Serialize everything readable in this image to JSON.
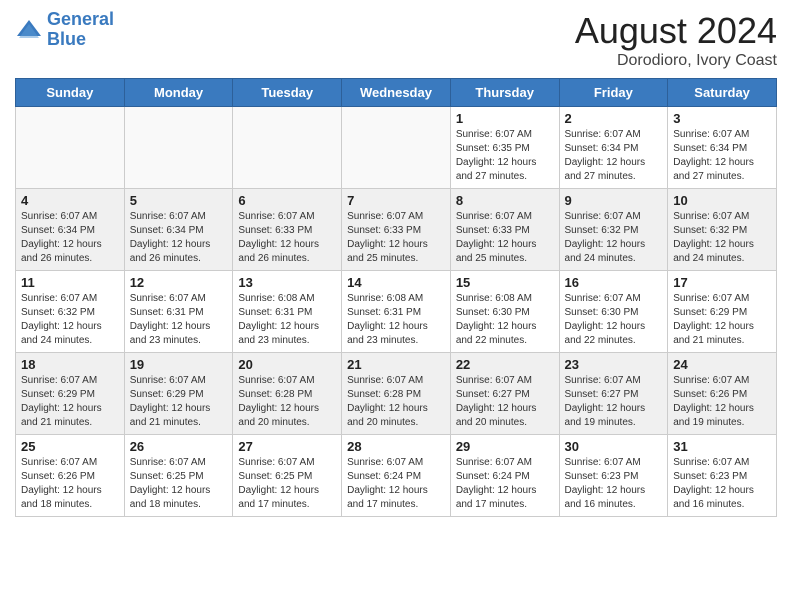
{
  "header": {
    "logo_line1": "General",
    "logo_line2": "Blue",
    "title": "August 2024",
    "subtitle": "Dorodioro, Ivory Coast"
  },
  "weekdays": [
    "Sunday",
    "Monday",
    "Tuesday",
    "Wednesday",
    "Thursday",
    "Friday",
    "Saturday"
  ],
  "weeks": [
    [
      {
        "day": "",
        "empty": true
      },
      {
        "day": "",
        "empty": true
      },
      {
        "day": "",
        "empty": true
      },
      {
        "day": "",
        "empty": true
      },
      {
        "day": "1",
        "sunrise": "6:07 AM",
        "sunset": "6:35 PM",
        "daylight": "12 hours and 27 minutes."
      },
      {
        "day": "2",
        "sunrise": "6:07 AM",
        "sunset": "6:34 PM",
        "daylight": "12 hours and 27 minutes."
      },
      {
        "day": "3",
        "sunrise": "6:07 AM",
        "sunset": "6:34 PM",
        "daylight": "12 hours and 27 minutes."
      }
    ],
    [
      {
        "day": "4",
        "sunrise": "6:07 AM",
        "sunset": "6:34 PM",
        "daylight": "12 hours and 26 minutes."
      },
      {
        "day": "5",
        "sunrise": "6:07 AM",
        "sunset": "6:34 PM",
        "daylight": "12 hours and 26 minutes."
      },
      {
        "day": "6",
        "sunrise": "6:07 AM",
        "sunset": "6:33 PM",
        "daylight": "12 hours and 26 minutes."
      },
      {
        "day": "7",
        "sunrise": "6:07 AM",
        "sunset": "6:33 PM",
        "daylight": "12 hours and 25 minutes."
      },
      {
        "day": "8",
        "sunrise": "6:07 AM",
        "sunset": "6:33 PM",
        "daylight": "12 hours and 25 minutes."
      },
      {
        "day": "9",
        "sunrise": "6:07 AM",
        "sunset": "6:32 PM",
        "daylight": "12 hours and 24 minutes."
      },
      {
        "day": "10",
        "sunrise": "6:07 AM",
        "sunset": "6:32 PM",
        "daylight": "12 hours and 24 minutes."
      }
    ],
    [
      {
        "day": "11",
        "sunrise": "6:07 AM",
        "sunset": "6:32 PM",
        "daylight": "12 hours and 24 minutes."
      },
      {
        "day": "12",
        "sunrise": "6:07 AM",
        "sunset": "6:31 PM",
        "daylight": "12 hours and 23 minutes."
      },
      {
        "day": "13",
        "sunrise": "6:08 AM",
        "sunset": "6:31 PM",
        "daylight": "12 hours and 23 minutes."
      },
      {
        "day": "14",
        "sunrise": "6:08 AM",
        "sunset": "6:31 PM",
        "daylight": "12 hours and 23 minutes."
      },
      {
        "day": "15",
        "sunrise": "6:08 AM",
        "sunset": "6:30 PM",
        "daylight": "12 hours and 22 minutes."
      },
      {
        "day": "16",
        "sunrise": "6:07 AM",
        "sunset": "6:30 PM",
        "daylight": "12 hours and 22 minutes."
      },
      {
        "day": "17",
        "sunrise": "6:07 AM",
        "sunset": "6:29 PM",
        "daylight": "12 hours and 21 minutes."
      }
    ],
    [
      {
        "day": "18",
        "sunrise": "6:07 AM",
        "sunset": "6:29 PM",
        "daylight": "12 hours and 21 minutes."
      },
      {
        "day": "19",
        "sunrise": "6:07 AM",
        "sunset": "6:29 PM",
        "daylight": "12 hours and 21 minutes."
      },
      {
        "day": "20",
        "sunrise": "6:07 AM",
        "sunset": "6:28 PM",
        "daylight": "12 hours and 20 minutes."
      },
      {
        "day": "21",
        "sunrise": "6:07 AM",
        "sunset": "6:28 PM",
        "daylight": "12 hours and 20 minutes."
      },
      {
        "day": "22",
        "sunrise": "6:07 AM",
        "sunset": "6:27 PM",
        "daylight": "12 hours and 20 minutes."
      },
      {
        "day": "23",
        "sunrise": "6:07 AM",
        "sunset": "6:27 PM",
        "daylight": "12 hours and 19 minutes."
      },
      {
        "day": "24",
        "sunrise": "6:07 AM",
        "sunset": "6:26 PM",
        "daylight": "12 hours and 19 minutes."
      }
    ],
    [
      {
        "day": "25",
        "sunrise": "6:07 AM",
        "sunset": "6:26 PM",
        "daylight": "12 hours and 18 minutes."
      },
      {
        "day": "26",
        "sunrise": "6:07 AM",
        "sunset": "6:25 PM",
        "daylight": "12 hours and 18 minutes."
      },
      {
        "day": "27",
        "sunrise": "6:07 AM",
        "sunset": "6:25 PM",
        "daylight": "12 hours and 17 minutes."
      },
      {
        "day": "28",
        "sunrise": "6:07 AM",
        "sunset": "6:24 PM",
        "daylight": "12 hours and 17 minutes."
      },
      {
        "day": "29",
        "sunrise": "6:07 AM",
        "sunset": "6:24 PM",
        "daylight": "12 hours and 17 minutes."
      },
      {
        "day": "30",
        "sunrise": "6:07 AM",
        "sunset": "6:23 PM",
        "daylight": "12 hours and 16 minutes."
      },
      {
        "day": "31",
        "sunrise": "6:07 AM",
        "sunset": "6:23 PM",
        "daylight": "12 hours and 16 minutes."
      }
    ]
  ]
}
